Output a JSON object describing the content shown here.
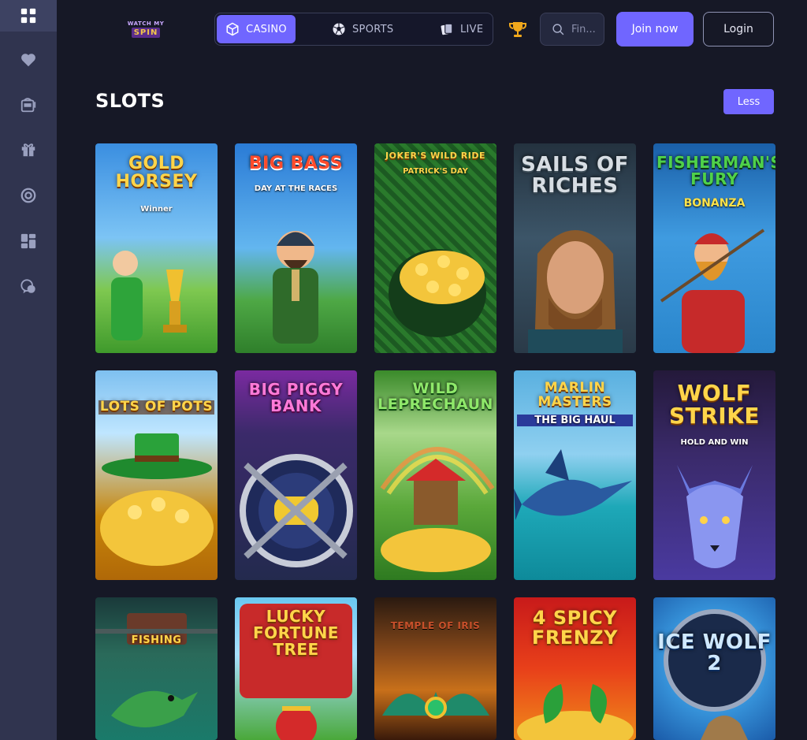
{
  "header": {
    "logo": {
      "line1": "WATCH MY",
      "line2": "SPIN"
    },
    "nav": [
      {
        "label": "CASINO",
        "icon": "cube-icon",
        "active": true
      },
      {
        "label": "SPORTS",
        "icon": "soccer-ball-icon",
        "active": false
      },
      {
        "label": "LIVE",
        "icon": "cards-icon",
        "active": false
      }
    ],
    "search_placeholder": "Fin...",
    "join_label": "Join now",
    "login_label": "Login"
  },
  "sidebar": {
    "items": [
      {
        "icon": "grid-icon",
        "active": true
      },
      {
        "icon": "heart-icon",
        "active": false
      },
      {
        "icon": "slot-machine-icon",
        "active": false
      },
      {
        "icon": "gift-icon",
        "active": false
      },
      {
        "icon": "target-icon",
        "active": false
      },
      {
        "icon": "dashboard-icon",
        "active": false
      },
      {
        "icon": "chat-support-icon",
        "active": false
      }
    ]
  },
  "section": {
    "title": "SLOTS",
    "less_label": "Less"
  },
  "games": [
    {
      "title": "GOLD HORSEY",
      "subtitle": "Winner"
    },
    {
      "title": "BIG BASS",
      "subtitle": "DAY AT THE RACES"
    },
    {
      "title": "JOKER'S WILD RIDE",
      "subtitle": "PATRICK'S DAY"
    },
    {
      "title": "SAILS OF RICHES",
      "subtitle": ""
    },
    {
      "title": "FISHERMAN'S FURY",
      "subtitle": "BONANZA"
    },
    {
      "title": "LOTS OF POTS",
      "subtitle": ""
    },
    {
      "title": "BIG PIGGY BANK",
      "subtitle": ""
    },
    {
      "title": "WILD LEPRECHAUN",
      "subtitle": ""
    },
    {
      "title": "MARLIN MASTERS",
      "subtitle": "THE BIG HAUL"
    },
    {
      "title": "WOLF STRIKE",
      "subtitle": "HOLD AND WIN"
    },
    {
      "title": "FISHING",
      "subtitle": ""
    },
    {
      "title": "LUCKY FORTUNE TREE",
      "subtitle": ""
    },
    {
      "title": "TEMPLE OF IRIS",
      "subtitle": ""
    },
    {
      "title": "4 SPICY FRENZY",
      "subtitle": ""
    },
    {
      "title": "ICE WOLF 2",
      "subtitle": ""
    }
  ],
  "colors": {
    "accent": "#7066ff",
    "background": "#161826",
    "sidebar": "#30344f"
  }
}
